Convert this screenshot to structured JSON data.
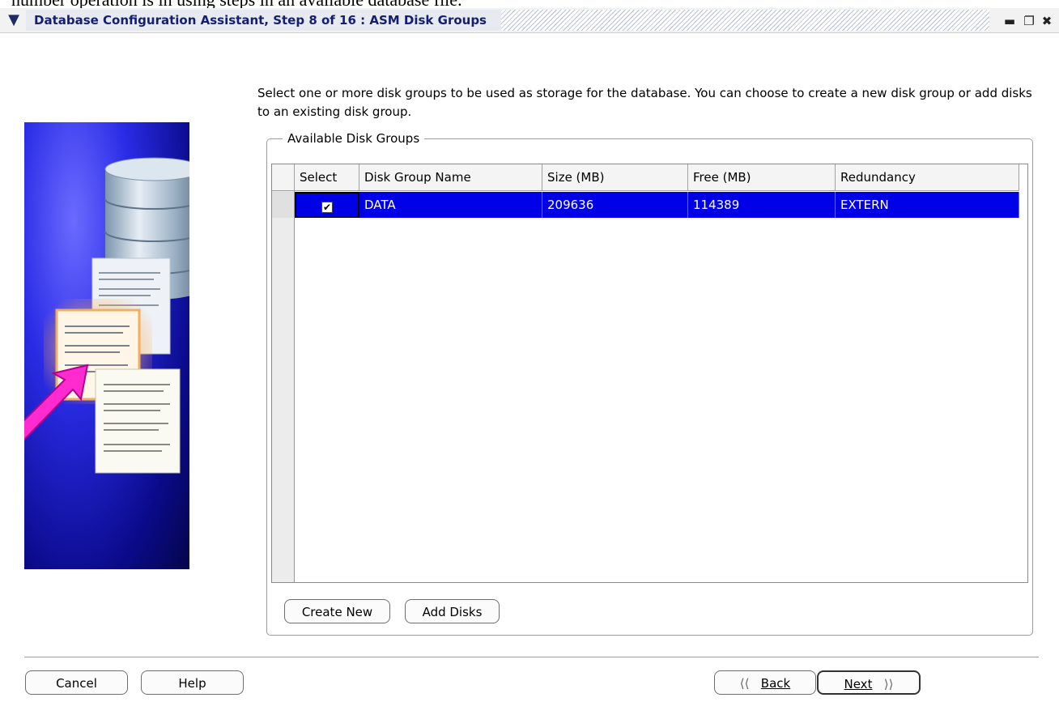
{
  "window": {
    "title": "Database Configuration Assistant, Step 8 of 16 : ASM Disk Groups",
    "top_text": "number operation is in using steps in an available database file."
  },
  "instructions": "Select one or more disk groups to be used as storage for the database. You can choose to create a new disk group or add disks to an existing disk group.",
  "groupbox": {
    "label": "Available Disk Groups"
  },
  "table": {
    "columns": [
      "Select",
      "Disk Group Name",
      "Size (MB)",
      "Free (MB)",
      "Redundancy"
    ],
    "rows": [
      {
        "selected": true,
        "name": "DATA",
        "size": "209636",
        "free": "114389",
        "redundancy": "EXTERN"
      }
    ]
  },
  "buttons": {
    "create_new": "Create New",
    "add_disks": "Add Disks",
    "cancel": "Cancel",
    "help": "Help",
    "back": "Back",
    "next": "Next"
  },
  "icons": {
    "window_menu": "chevron-down-icon",
    "minimize": "minimize-icon",
    "maximize": "maximize-icon",
    "close": "close-icon",
    "back": "double-chevron-left-icon",
    "next": "double-chevron-right-icon"
  },
  "colors": {
    "selection": "#0000e6",
    "title_text": "#14206f"
  }
}
